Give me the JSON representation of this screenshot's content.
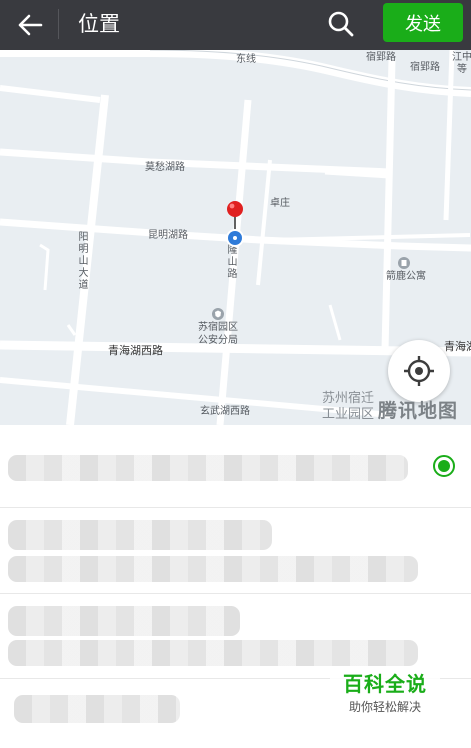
{
  "topbar": {
    "title": "位置",
    "send_label": "发送",
    "back_icon": "arrow-left-icon",
    "search_icon": "search-icon"
  },
  "map": {
    "roads": {
      "mochou": "莫愁湖路",
      "kunming": "昆明湖路",
      "yangmingshan": "阳明山大道",
      "longshan": "隆山路",
      "qinghai_west": "青海湖西路",
      "qinghai_right": "青海湖",
      "xuanwu_west": "玄武湖西路",
      "suyin": "宿郢路",
      "suying": "宿郢路",
      "top_partial": "东线",
      "right_top_partial": "江中等"
    },
    "pois": {
      "zhuozhuang": "卓庄",
      "jinglu": "箭鹿公寓",
      "police_line1": "苏宿园区",
      "police_line2": "公安分局",
      "park_line1": "苏州宿迁",
      "park_line2": "工业园区"
    },
    "watermark": "腾讯地图",
    "locate_icon": "locate-target-icon",
    "pin_icon": "red-pin-icon",
    "current_location_icon": "blue-location-dot-icon"
  },
  "list": {
    "selected_index": 0,
    "radio_icon": "radio-checked-icon"
  },
  "brand": {
    "main": "百科全说",
    "sub": "助你轻松解决"
  },
  "colors": {
    "topbar": "#393a3f",
    "send_button": "#1aad19",
    "radio": "#1aad19",
    "pin_red": "#e02020",
    "location_blue": "#2f7bd9",
    "map_bg": "#e9eef2"
  }
}
